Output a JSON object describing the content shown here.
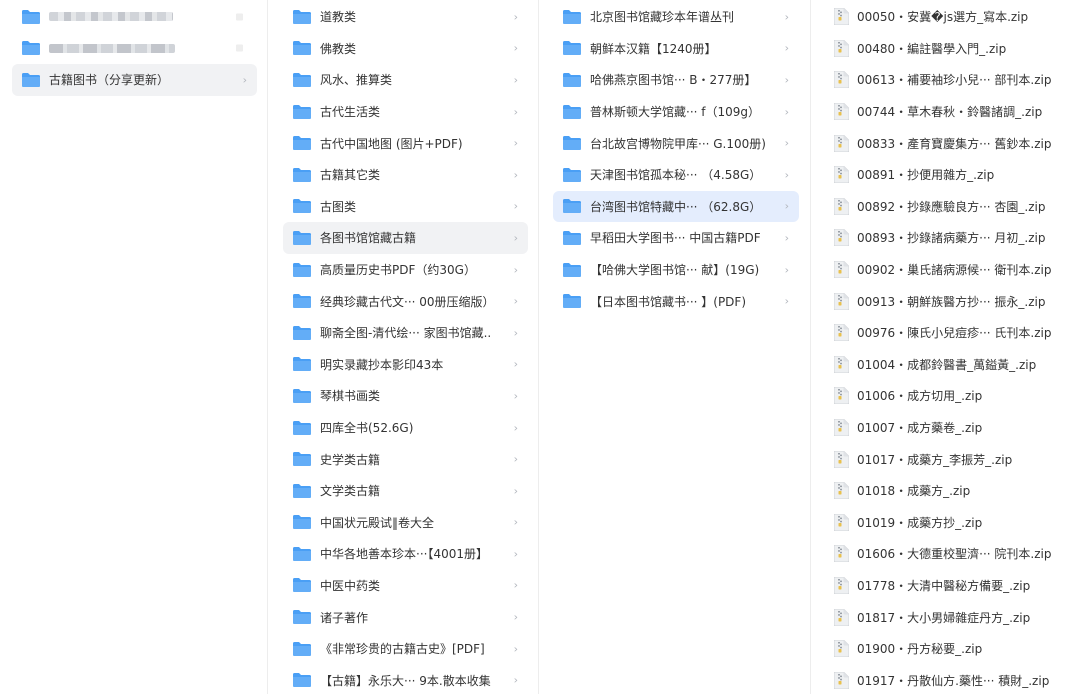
{
  "col1": {
    "items": [
      {
        "label": "",
        "chevron": ""
      },
      {
        "label": "",
        "chevron": ""
      },
      {
        "label": "古籍图书（分享更新）",
        "chevron": "›"
      }
    ]
  },
  "col2": {
    "items": [
      {
        "label": "道教类",
        "chevron": "›"
      },
      {
        "label": "佛教类",
        "chevron": "›"
      },
      {
        "label": "风水、推算类",
        "chevron": "›"
      },
      {
        "label": "古代生活类",
        "chevron": "›"
      },
      {
        "label": "古代中国地图 (图片+PDF)",
        "chevron": "›"
      },
      {
        "label": "古籍其它类",
        "chevron": "›"
      },
      {
        "label": "古图类",
        "chevron": "›"
      },
      {
        "label": "各图书馆馆藏古籍",
        "chevron": "›"
      },
      {
        "label": "高质量历史书PDF（约30G）",
        "chevron": "›"
      },
      {
        "label": "经典珍藏古代文···  00册压缩版）",
        "chevron": "›"
      },
      {
        "label": "聊斋全图-清代绘··· 家图书馆藏..",
        "chevron": "›"
      },
      {
        "label": "明实录藏抄本影印43本",
        "chevron": "›"
      },
      {
        "label": "琴棋书画类",
        "chevron": "›"
      },
      {
        "label": "四库全书(52.6G)",
        "chevron": "›"
      },
      {
        "label": "史学类古籍",
        "chevron": "›"
      },
      {
        "label": "文学类古籍",
        "chevron": "›"
      },
      {
        "label": "中国状元殿试‖卷大全",
        "chevron": "›"
      },
      {
        "label": "中华各地善本珍本···【4001册】",
        "chevron": "›"
      },
      {
        "label": "中医中药类",
        "chevron": "›"
      },
      {
        "label": "诸子著作",
        "chevron": "›"
      },
      {
        "label": "《非常珍贵的古籍古史》[PDF]",
        "chevron": "›"
      },
      {
        "label": "【古籍】永乐大··· 9本.散本收集",
        "chevron": "›"
      }
    ]
  },
  "col3": {
    "items": [
      {
        "label": "北京图书馆藏珍本年谱丛刊",
        "chevron": "›"
      },
      {
        "label": "朝鲜本汉籍【1240册】",
        "chevron": "›"
      },
      {
        "label": "哈佛燕京图书馆···  B・277册】",
        "chevron": "›"
      },
      {
        "label": "普林斯顿大学馆藏···  f（109g）",
        "chevron": "›"
      },
      {
        "label": "台北故宫博物院甲库··· G.100册)",
        "chevron": "›"
      },
      {
        "label": "天津图书馆孤本秘···  （4.58G）",
        "chevron": "›"
      },
      {
        "label": "台湾图书馆特藏中···   （62.8G）",
        "chevron": "›"
      },
      {
        "label": "早稻田大学图书··· 中国古籍PDF",
        "chevron": "›"
      },
      {
        "label": "【哈佛大学图书馆···  献】(19G)",
        "chevron": "›"
      },
      {
        "label": "【日本图书馆藏书···  】(PDF)",
        "chevron": "›"
      }
    ]
  },
  "col4": {
    "items": [
      {
        "label": "00050・安冀�js選方_寫本.zip"
      },
      {
        "label": "00480・編註醫學入門_.zip"
      },
      {
        "label": "00613・補要袖珍小兒··· 部刊本.zip"
      },
      {
        "label": "00744・草木春秋・鈴醫諸調_.zip"
      },
      {
        "label": "00833・產育寶慶集方··· 舊鈔本.zip"
      },
      {
        "label": "00891・抄便用雜方_.zip"
      },
      {
        "label": "00892・抄錄應驗良方···  杏園_.zip"
      },
      {
        "label": "00893・抄錄諸病藥方···  月初_.zip"
      },
      {
        "label": "00902・巢氏諸病源候··· 衛刊本.zip"
      },
      {
        "label": "00913・朝鮮族醫方抄···  振永_.zip"
      },
      {
        "label": "00976・陳氏小兒痘疹··· 氏刊本.zip"
      },
      {
        "label": "01004・成都鈴醫書_萬鎰黃_.zip"
      },
      {
        "label": "01006・成方切用_.zip"
      },
      {
        "label": "01007・成方藥卷_.zip"
      },
      {
        "label": "01017・成藥方_李振芳_.zip"
      },
      {
        "label": "01018・成藥方_.zip"
      },
      {
        "label": "01019・成藥方抄_.zip"
      },
      {
        "label": "01606・大德重校聖濟··· 院刊本.zip"
      },
      {
        "label": "01778・大清中醫秘方備要_.zip"
      },
      {
        "label": "01817・大小男婦雜症丹方_.zip"
      },
      {
        "label": "01900・丹方秘要_.zip"
      },
      {
        "label": "01917・丹散仙方.藥性···  積財_.zip"
      }
    ]
  },
  "colors": {
    "folder": "#4a9ff5",
    "selected_gray": "#f1f2f4",
    "selected_blue": "#e4edfd",
    "chevron": "#b4b8bf",
    "zip_file_icon": "#9aa0a8"
  }
}
